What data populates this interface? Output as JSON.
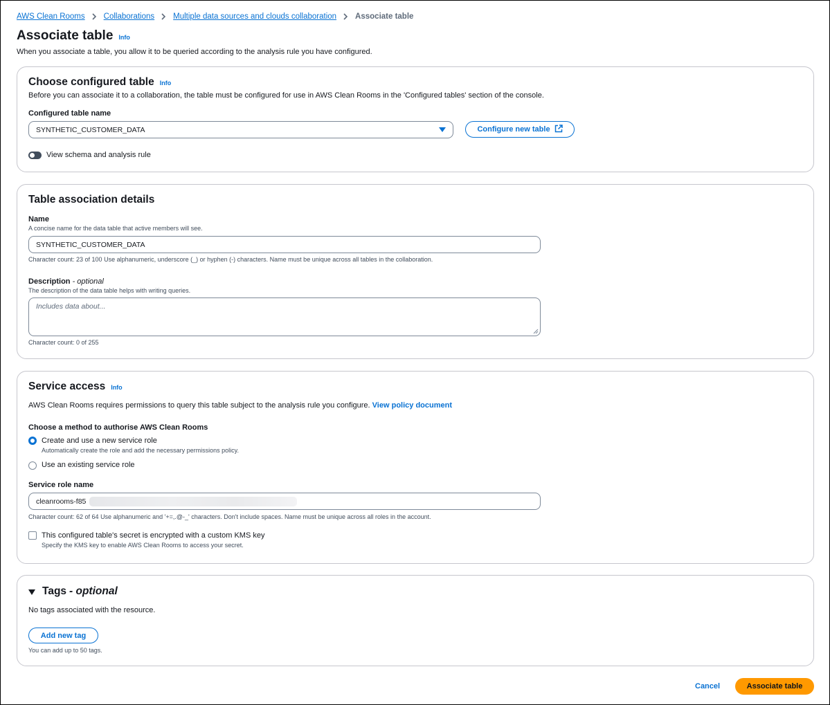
{
  "breadcrumb": {
    "items": [
      "AWS Clean Rooms",
      "Collaborations",
      "Multiple data sources and clouds collaboration"
    ],
    "current": "Associate table"
  },
  "page": {
    "title": "Associate table",
    "info": "Info",
    "description": "When you associate a table, you allow it to be queried according to the analysis rule you have configured."
  },
  "configured_table": {
    "heading": "Choose configured table",
    "info": "Info",
    "description": "Before you can associate it to a collaboration, the table must be configured for use in AWS Clean Rooms in the 'Configured tables' section of the console.",
    "name_label": "Configured table name",
    "selected": "SYNTHETIC_CUSTOMER_DATA",
    "configure_button": "Configure new table",
    "toggle_label": "View schema and analysis rule"
  },
  "association": {
    "heading": "Table association details",
    "name_label": "Name",
    "name_hint": "A concise name for the data table that active members will see.",
    "name_value": "SYNTHETIC_CUSTOMER_DATA",
    "name_constraint": "Character count: 23 of 100 Use alphanumeric, underscore (_) or hyphen (-) characters. Name must be unique across all tables in the collaboration.",
    "description_label": "Description",
    "description_optional": "- optional",
    "description_hint": "The description of the data table helps with writing queries.",
    "description_placeholder": "Includes data about...",
    "description_count": "Character count: 0 of 255"
  },
  "service_access": {
    "heading": "Service access",
    "info": "Info",
    "description": "AWS Clean Rooms requires permissions to query this table subject to the analysis rule you configure.",
    "policy_link": "View policy document",
    "method_label": "Choose a method to authorise AWS Clean Rooms",
    "option_new": "Create and use a new service role",
    "option_new_hint": "Automatically create the role and add the necessary permissions policy.",
    "option_existing": "Use an existing service role",
    "role_name_label": "Service role name",
    "role_name_value": "cleanrooms-f85",
    "role_name_constraint": "Character count: 62 of 64 Use alphanumeric and '+=,.@-_' characters. Don't include spaces. Name must be unique across all roles in the account.",
    "kms_label": "This configured table's secret is encrypted with a custom KMS key",
    "kms_hint": "Specify the KMS key to enable AWS Clean Rooms to access your secret."
  },
  "tags": {
    "heading": "Tags",
    "optional": "- optional",
    "empty": "No tags associated with the resource.",
    "add_button": "Add new tag",
    "limit": "You can add up to 50 tags."
  },
  "footer": {
    "cancel": "Cancel",
    "submit": "Associate table"
  },
  "colors": {
    "link": "#0972d3",
    "primary": "#ff9900",
    "border": "#c6c6cd"
  }
}
